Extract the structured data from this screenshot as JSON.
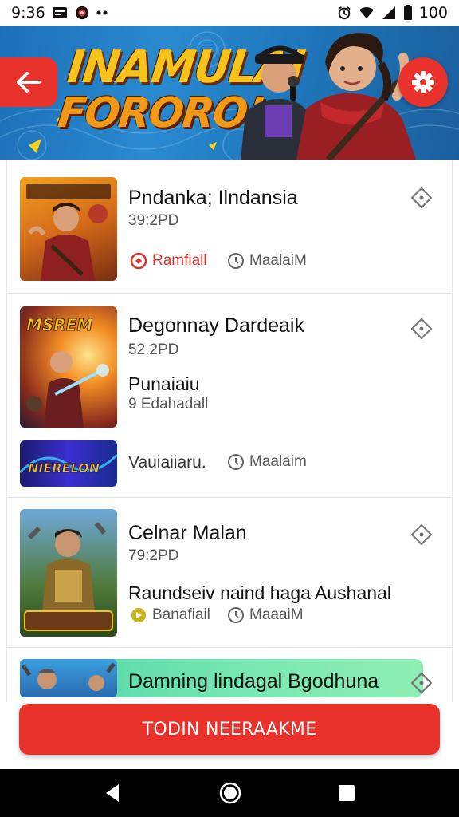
{
  "status_bar": {
    "time": "9:36",
    "battery": "100"
  },
  "header": {
    "title_line1": "INAMULAI",
    "title_line2": "FORORO!",
    "back_icon": "arrow-left-icon",
    "settings_icon": "gear-icon"
  },
  "cards": [
    {
      "title": "Pndanka; Ilndansia",
      "sub": "39:2PD",
      "meta_left": "Ramfiall",
      "meta_right": "MaalaiM"
    },
    {
      "title": "Degonnay Dardeaik",
      "sub": "52.2PD",
      "line": "Punaiaiu",
      "line_sub": "9 Edahadall",
      "thumb2_text": "NIERELON",
      "meta_left": "Vauiaiiaru.",
      "meta_right": "Maalaim",
      "thumb_text": "MSREM"
    },
    {
      "title": "Celnar Malan",
      "sub": "79:2PD",
      "line": "Raundseiv naind haga Aushanal",
      "meta_left": "Banafiail",
      "meta_right": "MaaaiM"
    },
    {
      "title": "Damning lindagal Bgodhuna"
    }
  ],
  "cta": {
    "label": "TODIN NEERAAKME"
  },
  "colors": {
    "accent": "#e8322b",
    "header_blue": "#2a8ad0"
  }
}
